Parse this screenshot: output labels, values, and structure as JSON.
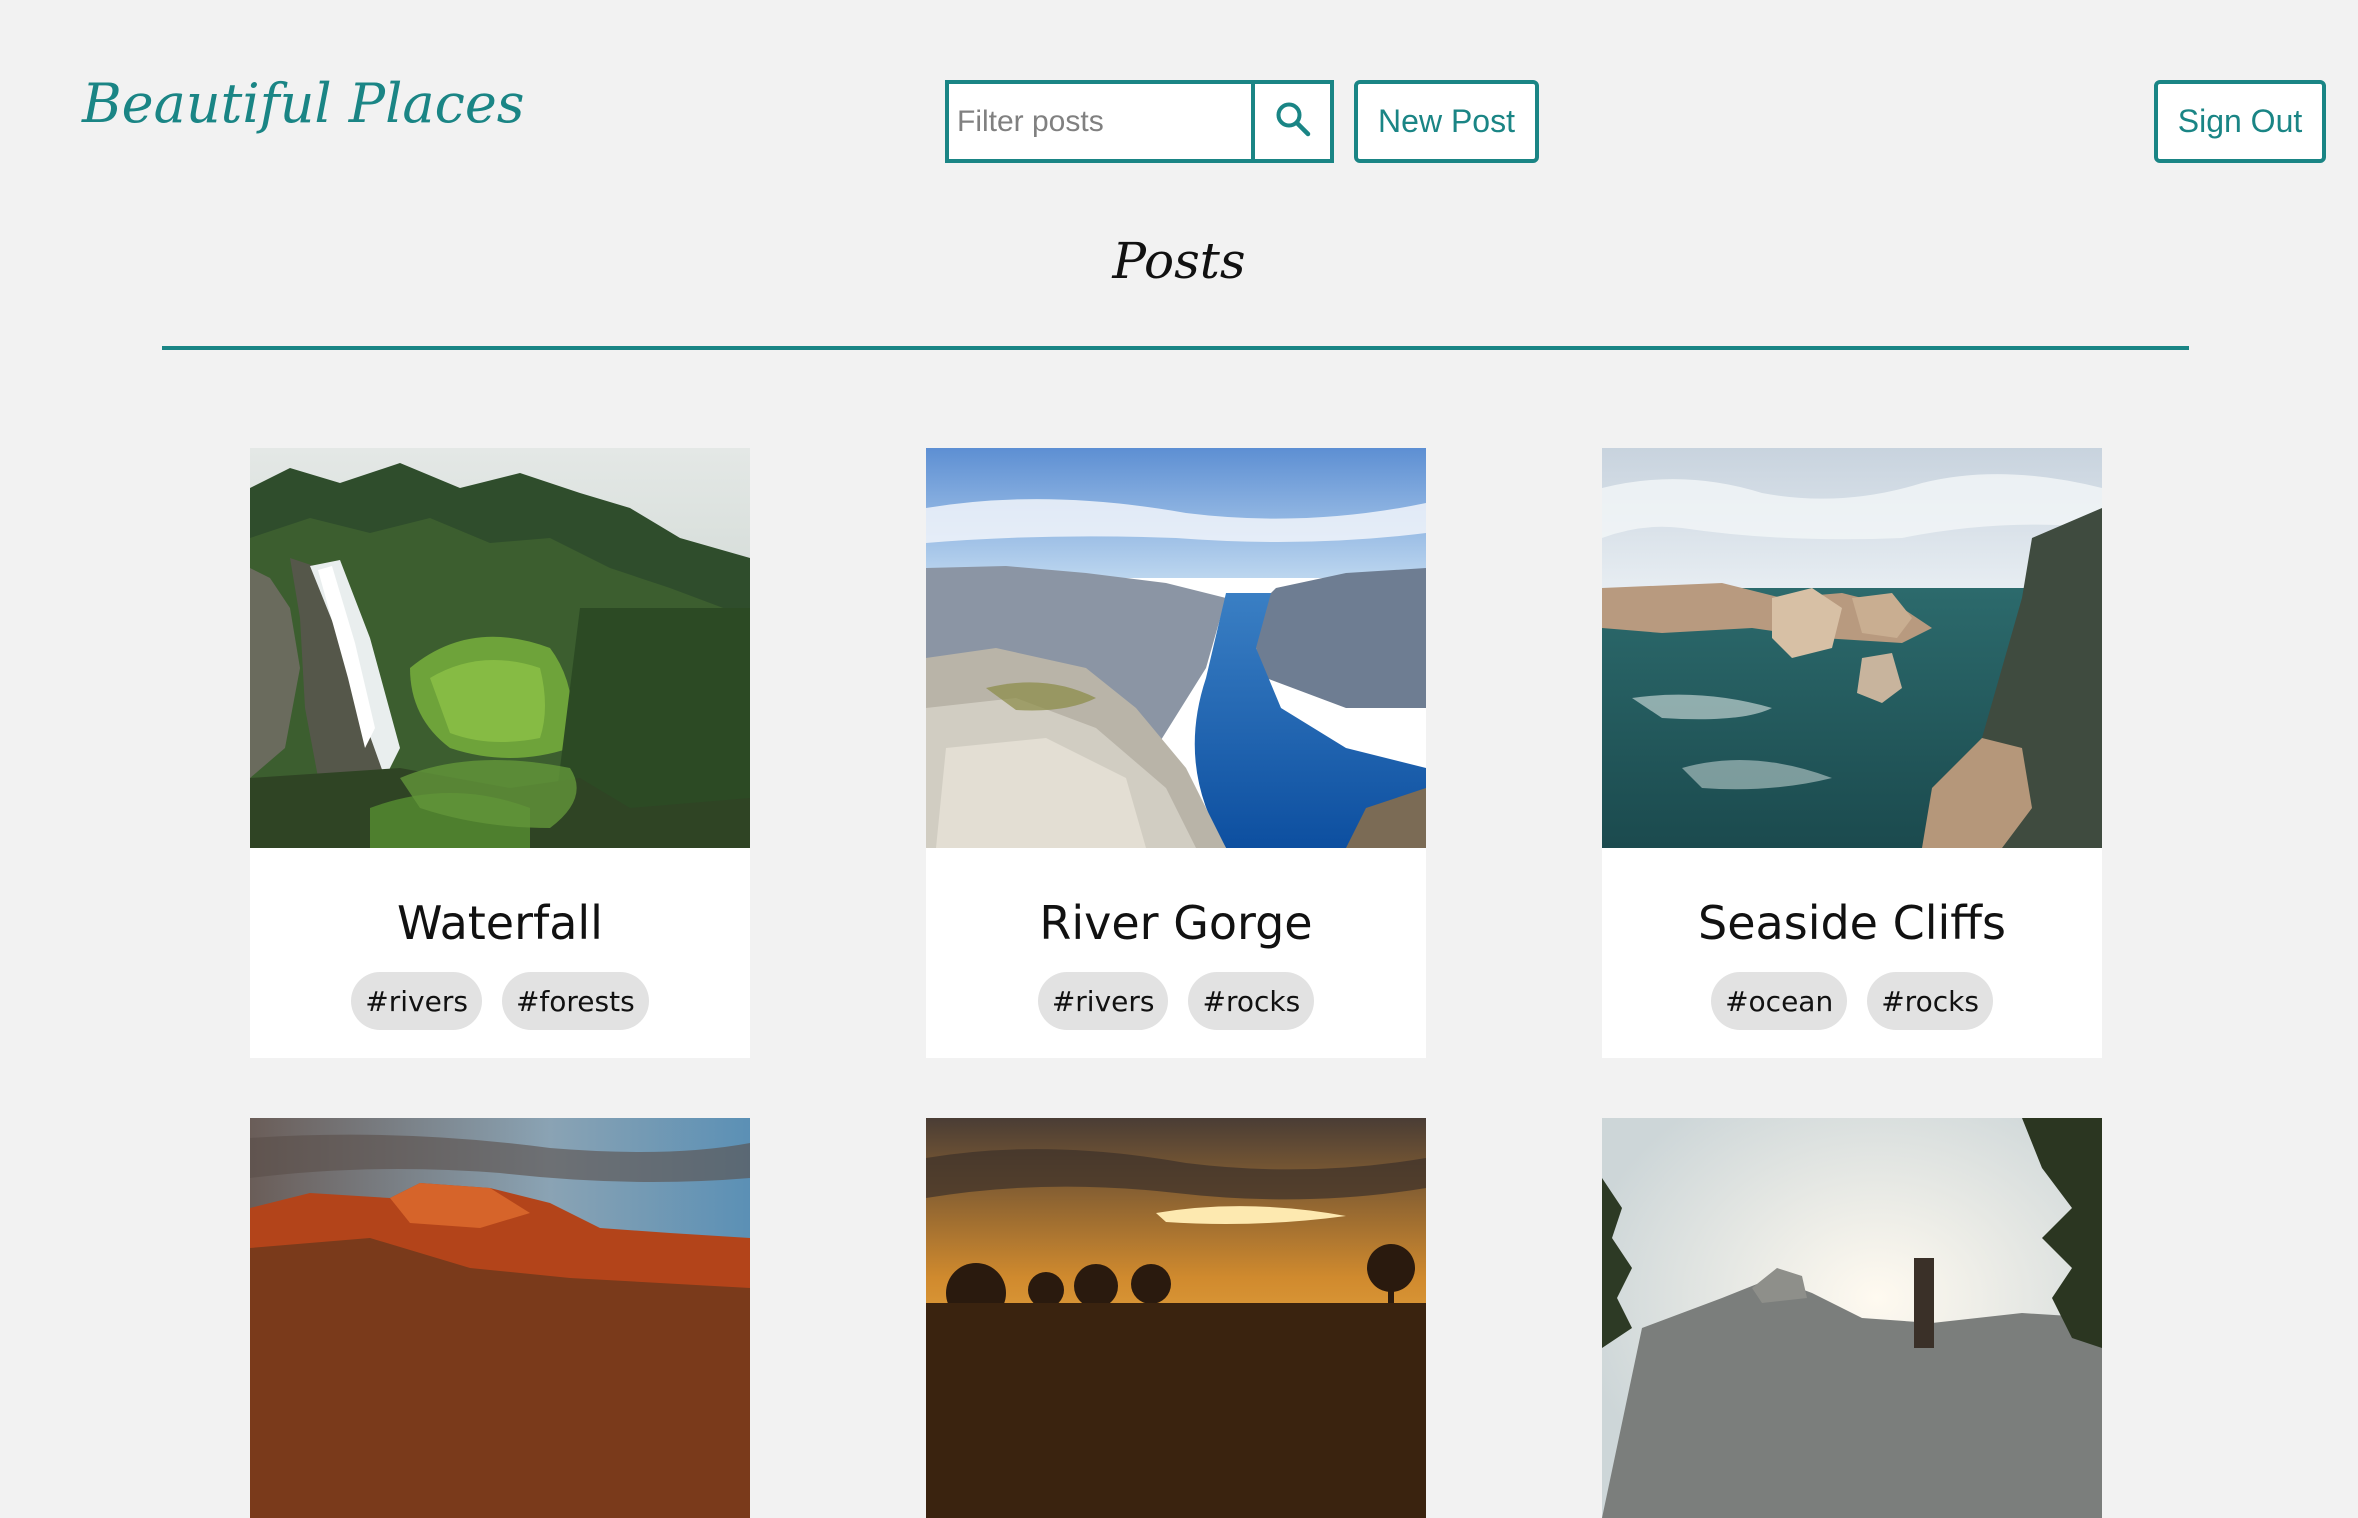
{
  "header": {
    "brand": "Beautiful Places",
    "search_placeholder": "Filter posts",
    "new_post_label": "New Post",
    "sign_out_label": "Sign Out"
  },
  "main": {
    "title": "Posts"
  },
  "posts": [
    {
      "title": "Waterfall",
      "tags": [
        "#rivers",
        "#forests"
      ],
      "image": "waterfall-photo"
    },
    {
      "title": "River Gorge",
      "tags": [
        "#rivers",
        "#rocks"
      ],
      "image": "fjord-photo"
    },
    {
      "title": "Seaside Cliffs",
      "tags": [
        "#ocean",
        "#rocks"
      ],
      "image": "sea-cliffs-photo"
    },
    {
      "title": "",
      "tags": [],
      "image": "red-rock-canyon-photo"
    },
    {
      "title": "",
      "tags": [],
      "image": "sunset-trees-photo"
    },
    {
      "title": "",
      "tags": [],
      "image": "valley-sunrise-photo"
    }
  ],
  "colors": {
    "accent": "#1a8585",
    "background": "#f2f2f2",
    "card": "#ffffff",
    "tag": "#e2e2e2"
  }
}
